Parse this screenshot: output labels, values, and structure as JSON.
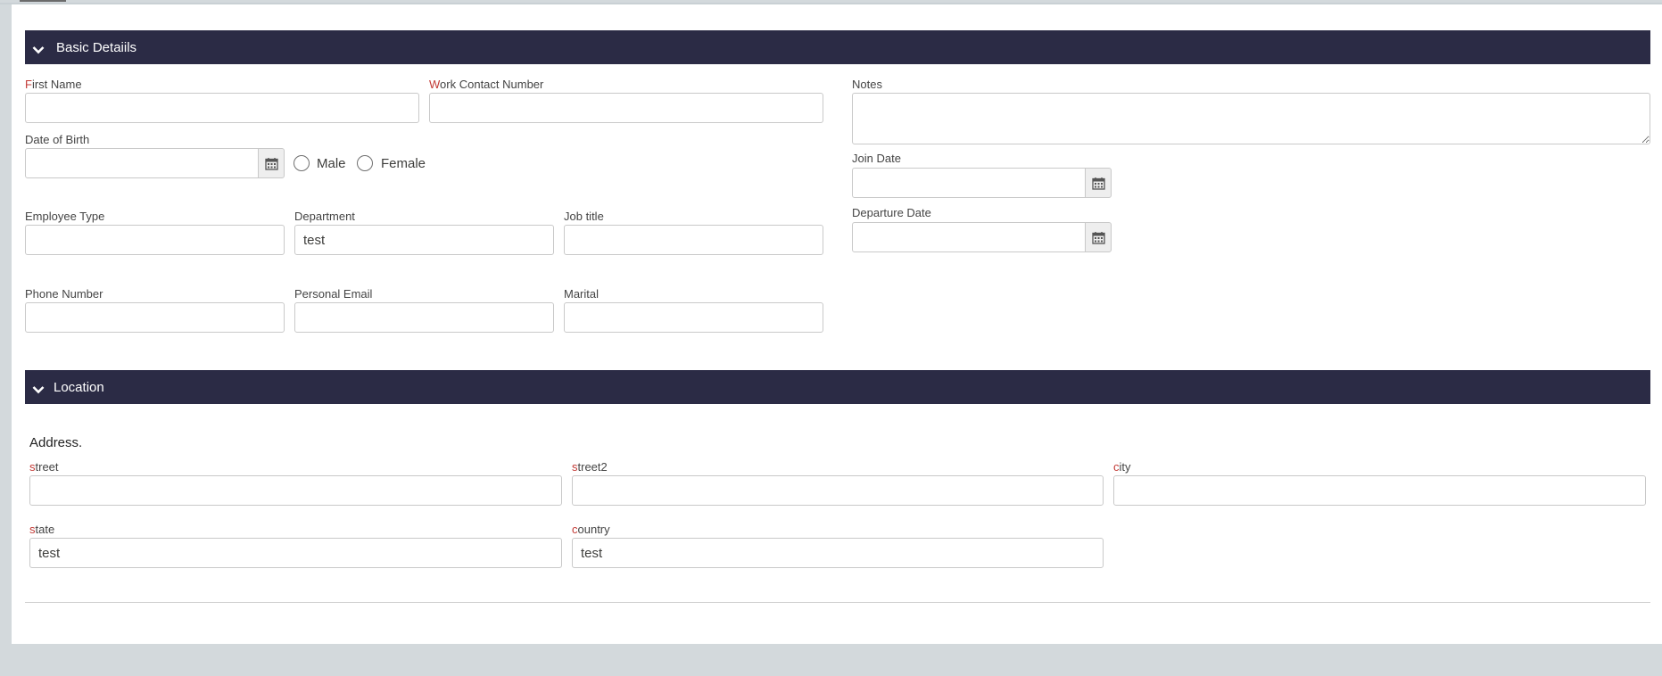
{
  "sections": {
    "basic": {
      "title": "Basic Detaiils"
    },
    "location": {
      "title": "Location"
    }
  },
  "fields": {
    "first_name": {
      "req": "F",
      "rest": "irst Name",
      "value": ""
    },
    "work_contact": {
      "req": "W",
      "rest": "ork Contact Number",
      "value": ""
    },
    "notes": {
      "label": "Notes",
      "value": ""
    },
    "dob": {
      "label": "Date of Birth",
      "value": ""
    },
    "join_date": {
      "label": "Join Date",
      "value": ""
    },
    "departure_date": {
      "label": "Departure Date",
      "value": ""
    },
    "employee_type": {
      "label": "Employee Type",
      "value": ""
    },
    "department": {
      "label": "Department",
      "value": "test"
    },
    "job_title": {
      "label": "Job title",
      "value": ""
    },
    "phone": {
      "label": "Phone Number",
      "value": ""
    },
    "personal_email": {
      "label": "Personal Email",
      "value": ""
    },
    "marital": {
      "label": "Marital",
      "value": ""
    }
  },
  "gender": {
    "male": "Male",
    "female": "Female"
  },
  "address": {
    "heading": "Address.",
    "street": {
      "req": "s",
      "rest": "treet",
      "value": ""
    },
    "street2": {
      "req": "s",
      "rest": "treet2",
      "value": ""
    },
    "city": {
      "req": "c",
      "rest": "ity",
      "value": ""
    },
    "state": {
      "req": "s",
      "rest": "tate",
      "value": "test"
    },
    "country": {
      "req": "c",
      "rest": "ountry",
      "value": "test"
    }
  },
  "icons": {
    "section_toggle": "chevron-down-icon",
    "date_picker": "calendar-icon"
  },
  "colors": {
    "header_bg": "#2b2b45",
    "required": "#c23934",
    "page_bg": "#d3d9dc"
  }
}
